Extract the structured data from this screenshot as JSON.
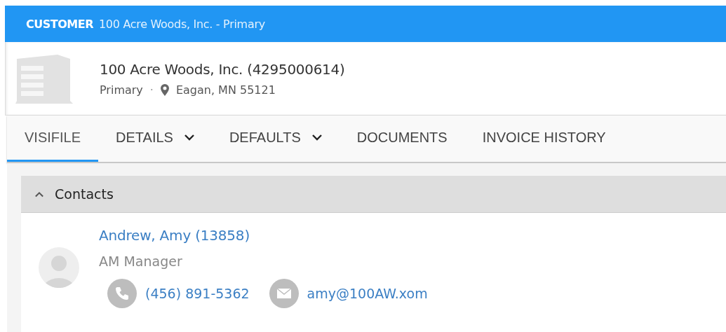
{
  "header": {
    "label": "CUSTOMER",
    "title": "100 Acre Woods, Inc. - Primary"
  },
  "customer": {
    "name": "100 Acre Woods, Inc. (4295000614)",
    "type": "Primary",
    "separator": "·",
    "location": "Eagan, MN 55121"
  },
  "tabs": [
    {
      "label": "VISIFILE",
      "selected": true,
      "dropdown": false
    },
    {
      "label": "DETAILS",
      "selected": false,
      "dropdown": true
    },
    {
      "label": "DEFAULTS",
      "selected": false,
      "dropdown": true
    },
    {
      "label": "DOCUMENTS",
      "selected": false,
      "dropdown": false
    },
    {
      "label": "INVOICE HISTORY",
      "selected": false,
      "dropdown": false
    }
  ],
  "contacts": {
    "title": "Contacts",
    "expanded": true,
    "items": [
      {
        "name": "Andrew, Amy (13858)",
        "role": "AM Manager",
        "phone": "(456) 891-5362",
        "email": "amy@100AW.xom"
      }
    ]
  }
}
